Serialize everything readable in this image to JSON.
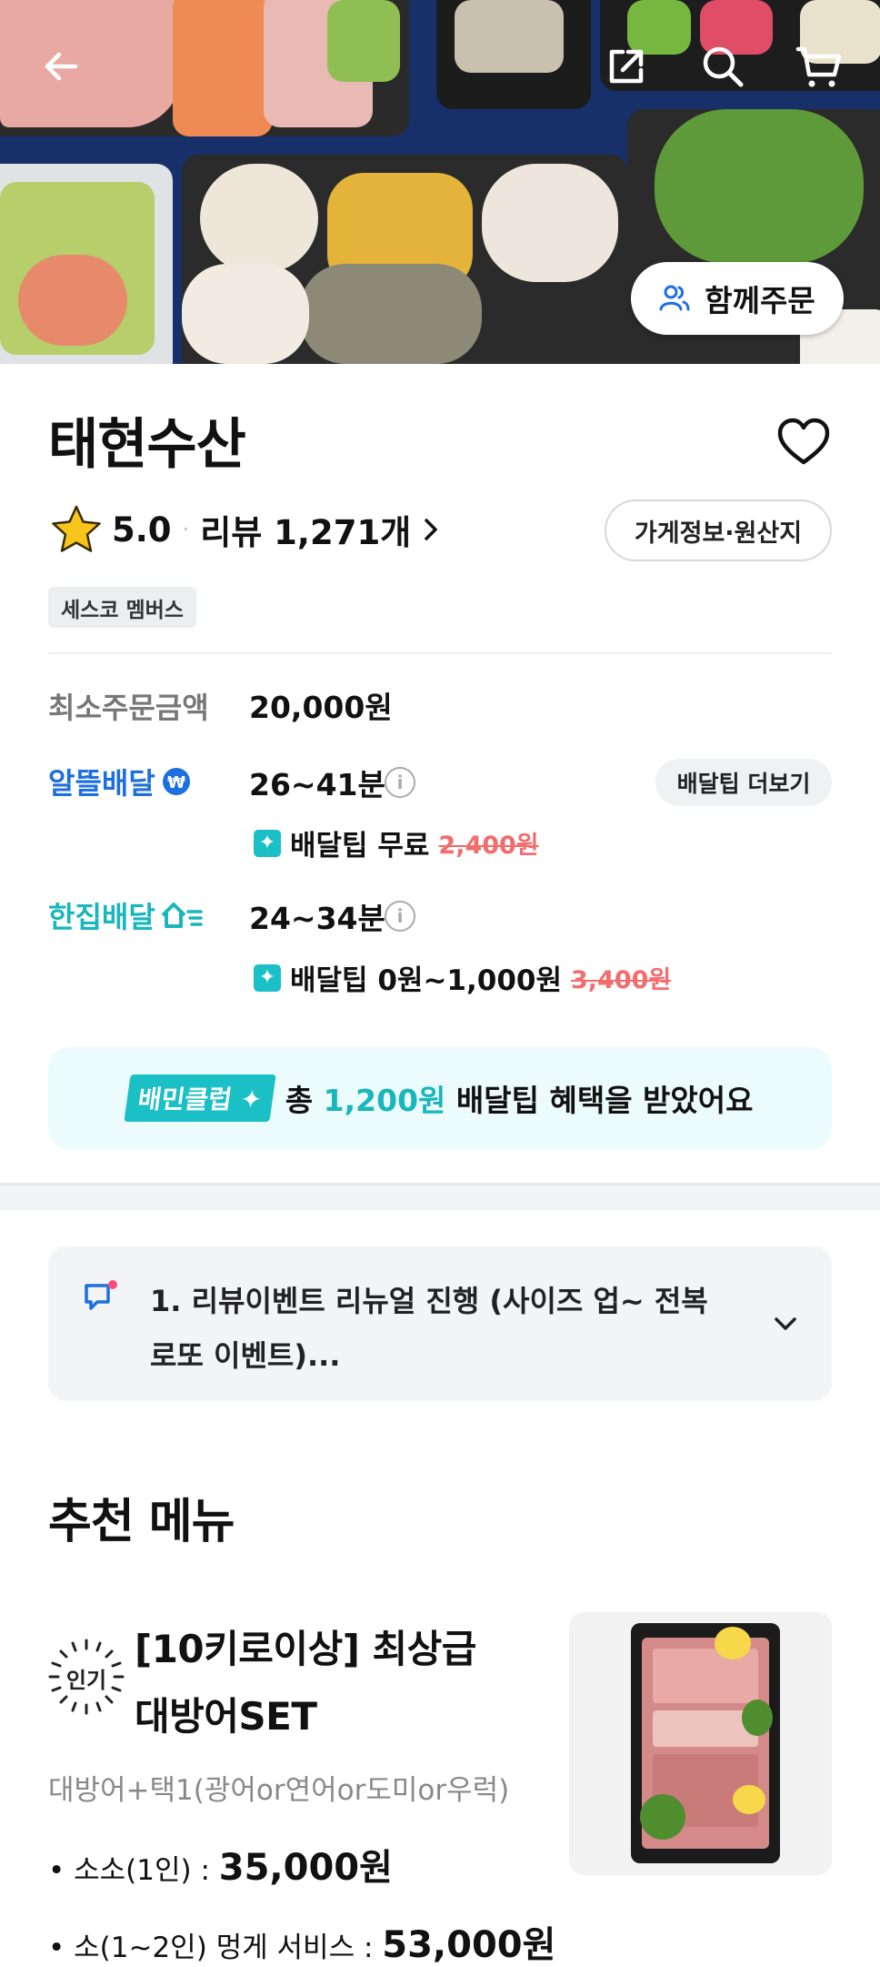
{
  "hero": {
    "together_order_label": "함께주문",
    "icons": [
      "back-arrow-icon",
      "share-icon",
      "search-icon",
      "cart-icon"
    ]
  },
  "store": {
    "name": "태현수산",
    "rating": "5.0",
    "review_label": "리뷰 1,271개",
    "info_button": "가게정보·원산지",
    "member_badge": "세스코 멤버스"
  },
  "info": {
    "min_order_label": "최소주문금액",
    "min_order_value": "20,000원",
    "delivery1": {
      "label": "알뜰배달",
      "time": "26~41분",
      "tip_main": "배달팁 무료",
      "tip_original": "2,400원"
    },
    "tip_more": "배달팁 더보기",
    "delivery2": {
      "label": "한집배달",
      "time": "24~34분",
      "tip_main": "배달팁 0원~1,000원",
      "tip_original": "3,400원"
    }
  },
  "club": {
    "badge": "배민클럽",
    "prefix": "총",
    "amount": "1,200원",
    "suffix": "배달팁 혜택을 받았어요"
  },
  "notice": {
    "text": "1. 리뷰이벤트 리뉴얼 진행 (사이즈 업~ 전복 로또 이벤트)..."
  },
  "recommended": {
    "title": "추천 메뉴",
    "item": {
      "badge": "인기",
      "name": "[10키로이상] 최상급 대방어SET",
      "desc": "대방어+택1(광어or연어or도미or우럭)",
      "prices": [
        {
          "label": "• 소소(1인) : ",
          "value": "35,000원"
        },
        {
          "label": "• 소(1~2인) 멍게 서비스 : ",
          "value": "53,000원"
        }
      ]
    }
  },
  "colors": {
    "accent_blue": "#1e6fe0",
    "accent_teal": "#19b6bc",
    "strike_red": "#f26d6d"
  }
}
